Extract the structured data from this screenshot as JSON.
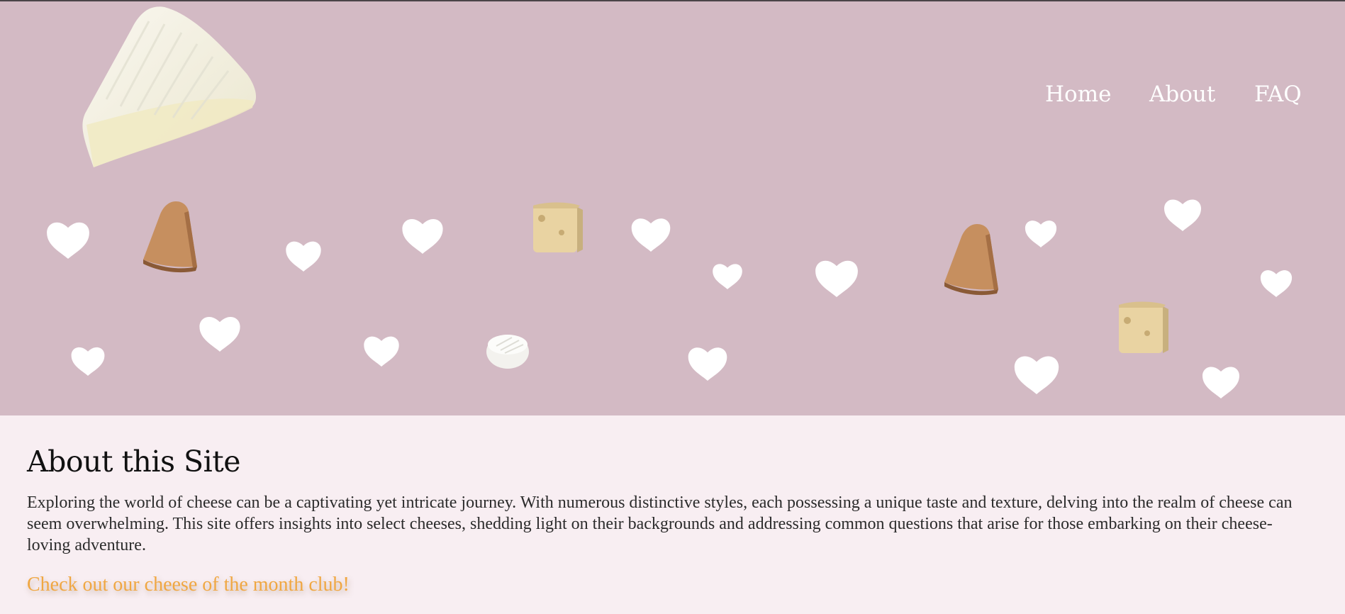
{
  "nav": {
    "home_label": "Home",
    "about_label": "About",
    "faq_label": "FAQ"
  },
  "about": {
    "heading": "About this Site",
    "body": "Exploring the world of cheese can be a captivating yet intricate journey. With numerous distinctive styles, each possessing a unique taste and texture, delving into the realm of cheese can seem overwhelming. This site offers insights into select cheeses, shedding light on their backgrounds and addressing common questions that arise for those embarking on their cheese-loving adventure.",
    "club_link": "Check out our cheese of the month club!"
  },
  "colors": {
    "hero_background": "#d3bac4",
    "page_background": "#f8eef2",
    "nav_text": "#ffffff",
    "link_accent": "#f0a742"
  },
  "decorations": {
    "hero_icons": [
      "brie-wedge-icon",
      "heart-icon",
      "cheese-wedge-icon",
      "swiss-cube-icon",
      "camembert-icon"
    ]
  }
}
